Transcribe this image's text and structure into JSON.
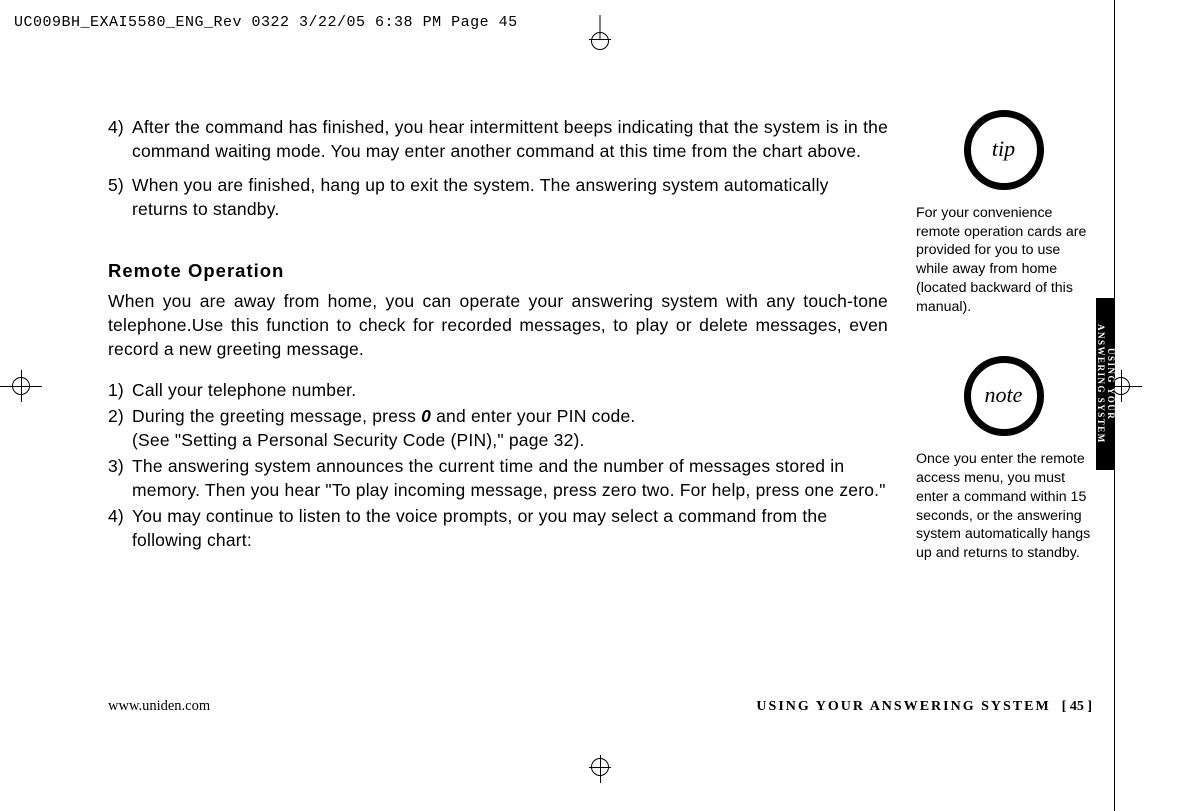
{
  "header": "UC009BH_EXAI5580_ENG_Rev 0322  3/22/05  6:38 PM  Page 45",
  "main": {
    "items_top": [
      {
        "num": "4)",
        "text": "After the command has finished, you hear intermittent beeps indicating that the system is in the command waiting mode. You may enter another command at this time from the chart above."
      },
      {
        "num": "5)",
        "text": "When you are finished, hang up to exit the system. The answering system automatically returns to standby."
      }
    ],
    "heading": "Remote Operation",
    "para": "When you are away from home, you can operate your answering system with any touch-tone telephone.Use this function to check for recorded messages, to play or delete messages, even record a new greeting message.",
    "items_bottom": [
      {
        "num": "1)",
        "text": "Call your telephone number."
      },
      {
        "num": "2)",
        "text_pre": "During the greeting message, press ",
        "bold": "0",
        "text_post": " and enter your PIN code.",
        "line2": "(See \"Setting a Personal Security Code (PIN),\" page 32)."
      },
      {
        "num": "3)",
        "text": "The answering system announces the current time and the number of messages stored in memory. Then you hear \"To play incoming message, press zero two. For help, press one zero.\""
      },
      {
        "num": "4)",
        "text": "You may continue to listen to the voice prompts, or you may select a command from the following chart:"
      }
    ]
  },
  "sidebar": {
    "tip_label": "tip",
    "tip_text": "For your convenience remote operation cards are provided for you to use while away from home (located backward of this manual).",
    "note_label": "note",
    "note_text": "Once you enter the remote access menu, you must enter a command within 15 seconds, or the answering system automatically hangs up and returns to standby."
  },
  "tab": "USING YOUR ANSWERING SYSTEM",
  "footer": {
    "url": "www.uniden.com",
    "section": "USING YOUR ANSWERING SYSTEM",
    "page": "[ 45 ]"
  }
}
